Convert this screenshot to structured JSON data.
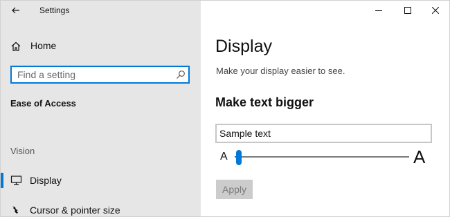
{
  "window": {
    "title": "Settings",
    "controls": {
      "minimize_icon": "minimize-icon",
      "maximize_icon": "maximize-icon",
      "close_icon": "close-icon"
    }
  },
  "sidebar": {
    "back_icon": "back-arrow-icon",
    "home_label": "Home",
    "search_placeholder": "Find a setting",
    "section_heading": "Ease of Access",
    "group_label": "Vision",
    "items": [
      {
        "label": "Display",
        "icon": "monitor-icon",
        "selected": true
      },
      {
        "label": "Cursor & pointer size",
        "icon": "cursor-icon",
        "selected": false
      }
    ]
  },
  "main": {
    "title": "Display",
    "subtitle": "Make your display easier to see.",
    "text_size": {
      "heading": "Make text bigger",
      "sample_text": "Sample text",
      "slider_min_label": "A",
      "slider_max_label": "A",
      "slider_value": 0.01
    },
    "apply_label": "Apply"
  },
  "colors": {
    "accent": "#0078d7",
    "sidebar_bg": "#e6e6e6",
    "content_bg": "#ffffff",
    "button_disabled_bg": "#cccccc"
  }
}
